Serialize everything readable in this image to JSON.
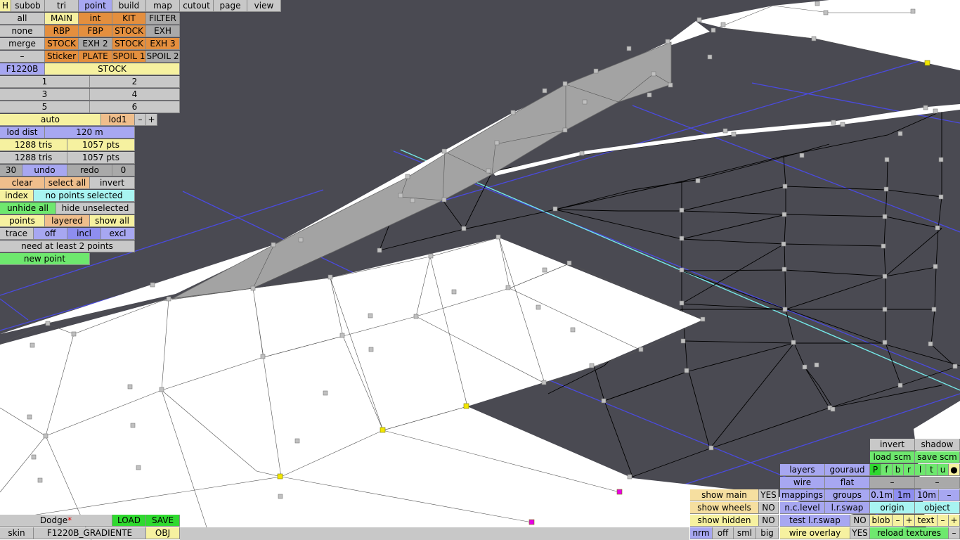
{
  "top_menu": [
    "H",
    "subob",
    "tri",
    "point",
    "build",
    "map",
    "cutout",
    "page",
    "view"
  ],
  "left_panel": {
    "r1": [
      "all",
      "MAIN",
      "int",
      "KIT",
      "FILTER"
    ],
    "r2": [
      "none",
      "RBP",
      "FBP",
      "STOCK",
      "EXH"
    ],
    "r3": [
      "merge",
      "STOCK",
      "EXH 2",
      "STOCK",
      "EXH 3"
    ],
    "r4": [
      "–",
      "Sticker",
      "PLATE",
      "SPOIL 1",
      "SPOIL 2"
    ],
    "object_name": "F1220B",
    "object_part": "STOCK",
    "nums": [
      "1",
      "2",
      "3",
      "4",
      "5",
      "6"
    ],
    "lod_mode": "auto",
    "lod_level": "lod1",
    "minus": "–",
    "plus": "+",
    "lod_dist_label": "lod dist",
    "lod_dist_value": "120 m",
    "tris_a": "1288 tris",
    "pts_a": "1057 pts",
    "tris_b": "1288 tris",
    "pts_b": "1057 pts",
    "undo_count": "30",
    "undo": "undo",
    "redo": "redo",
    "redo_count": "0",
    "clear": "clear",
    "select_all": "select all",
    "invert": "invert",
    "index": "index",
    "selection_status": "no points selected",
    "unhide_all": "unhide all",
    "hide_unselected": "hide unselected",
    "points": "points",
    "layered": "layered",
    "show_all": "show all",
    "trace": "trace",
    "off": "off",
    "incl": "incl",
    "excl": "excl",
    "message": "need at least 2 points",
    "new_point": "new point"
  },
  "bottom_left": {
    "car": "Dodge",
    "asterisk": "*",
    "load": "LOAD",
    "save": "SAVE",
    "skin_label": "skin",
    "skin_name": "F1220B_GRADIENTE",
    "obj": "OBJ"
  },
  "bottom_right": {
    "show_main": "show main",
    "show_main_val": "YES",
    "show_wheels": "show wheels",
    "show_wheels_val": "NO",
    "show_hidden": "show hidden",
    "show_hidden_val": "NO",
    "nrm": "nrm",
    "off": "off",
    "sml": "sml",
    "big": "big",
    "layers": "layers",
    "gouraud": "gouraud",
    "wire": "wire",
    "flat": "flat",
    "mappings": "mappings",
    "groups": "groups",
    "nc_level": "n.c.level",
    "lr_swap": "l.r.swap",
    "test_lr_swap": "test l.r.swap",
    "test_lr_swap_val": "NO",
    "wire_overlay": "wire overlay",
    "wire_overlay_val": "YES",
    "invert": "invert",
    "shadow": "shadow",
    "load_scm": "load scm",
    "save_scm": "save scm",
    "flags": [
      "P",
      "f",
      "b",
      "r",
      "l",
      "t",
      "u",
      "●"
    ],
    "dash1": "–",
    "dash2": "–",
    "d01": "0.1m",
    "d1": "1m",
    "d10": "10m",
    "dminus": "–",
    "origin": "origin",
    "object": "object",
    "blob": "blob",
    "blob_minus": "–",
    "blob_plus": "+",
    "text": "text",
    "text_minus": "–",
    "text_plus": "+",
    "reload_textures": "reload textures",
    "reload_minus": "–"
  }
}
